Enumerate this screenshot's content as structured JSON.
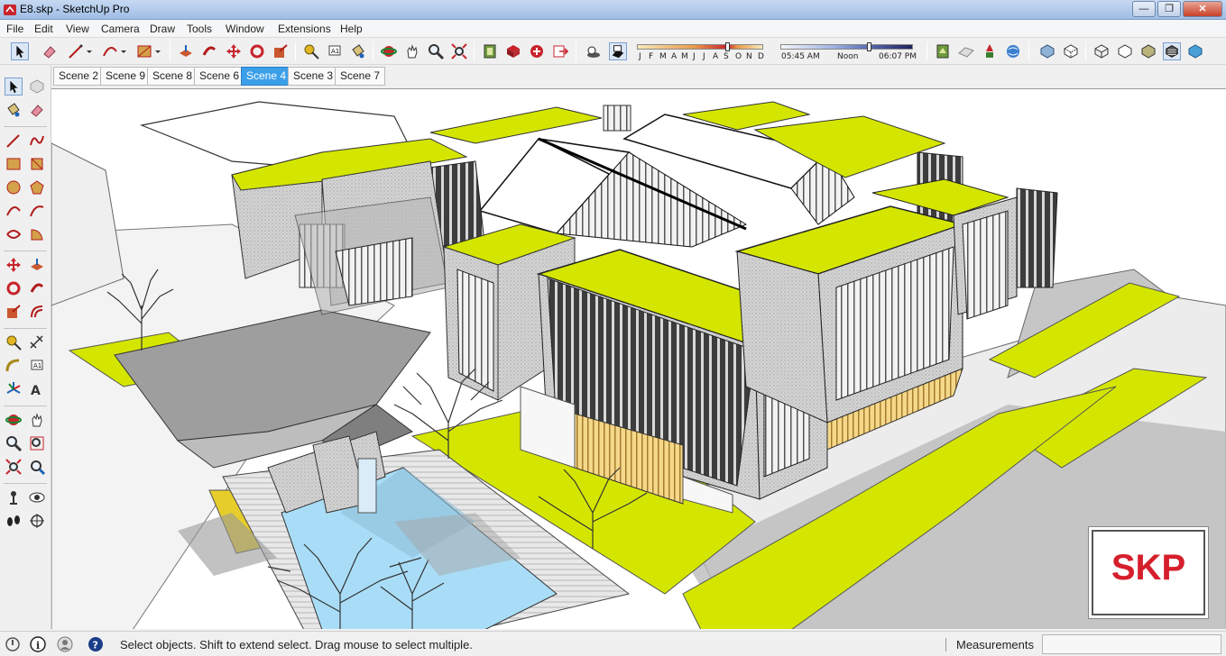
{
  "window": {
    "title": "E8.skp - SketchUp Pro",
    "minimize_glyph": "—",
    "maximize_glyph": "❐",
    "close_glyph": "✕"
  },
  "menu": [
    "File",
    "Edit",
    "View",
    "Camera",
    "Draw",
    "Tools",
    "Window",
    "Extensions",
    "Help"
  ],
  "shadow_panel": {
    "months": [
      "J",
      "F",
      "M",
      "A",
      "M",
      "J",
      "J",
      "A",
      "S",
      "O",
      "N",
      "D"
    ],
    "time_start": "05:45 AM",
    "time_mid": "Noon",
    "time_end": "06:07 PM"
  },
  "scenes": {
    "tabs": [
      "Scene 2",
      "Scene 9",
      "Scene 8",
      "Scene 6",
      "Scene 4",
      "Scene 3",
      "Scene 7"
    ],
    "active": "Scene 4"
  },
  "status": {
    "hint": "Select objects. Shift to extend select. Drag mouse to select multiple.",
    "measurements_label": "Measurements",
    "measurements_value": ""
  },
  "badge": {
    "text": "SKP"
  },
  "colors": {
    "roof_green": "#d4e600",
    "pool_blue": "#a9ddf7",
    "active_tab": "#3b9fe8",
    "badge_red": "#d61f2c"
  }
}
